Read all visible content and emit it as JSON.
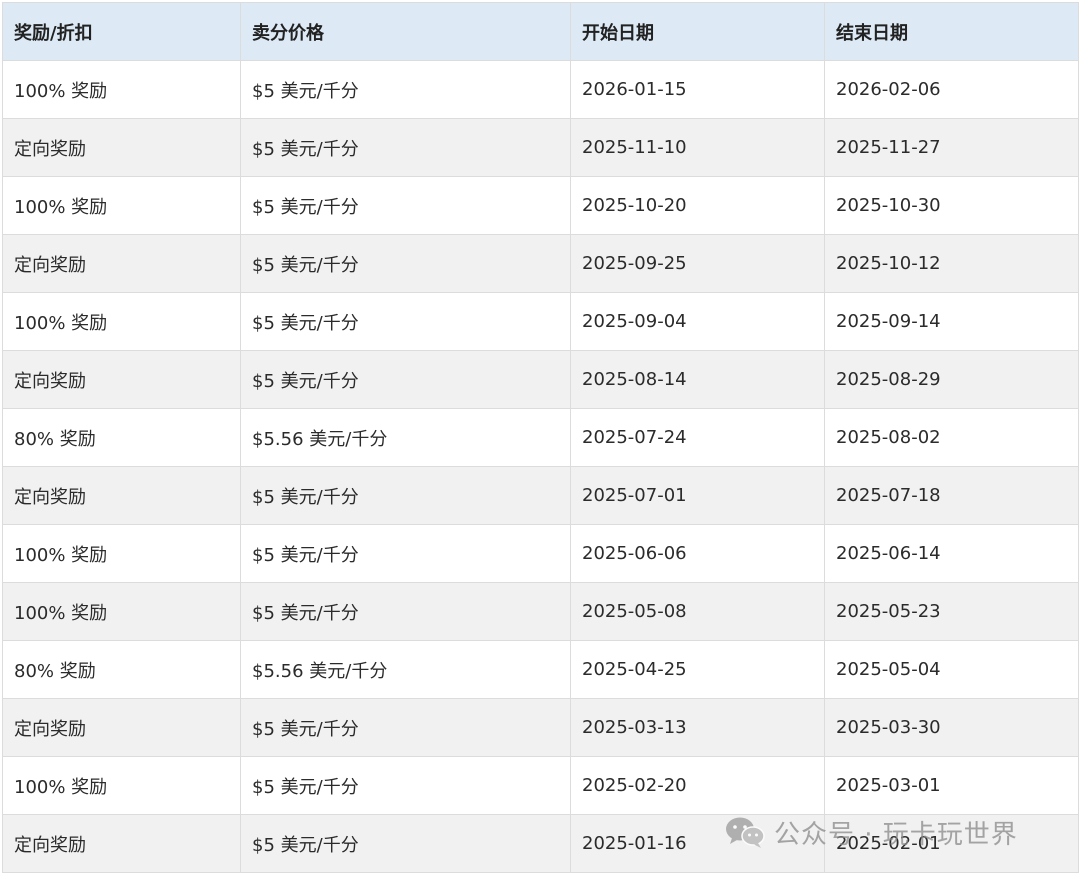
{
  "table": {
    "headers": [
      "奖励/折扣",
      "卖分价格",
      "开始日期",
      "结束日期"
    ],
    "rows": [
      [
        "100% 奖励",
        "$5 美元/千分",
        "2026-01-15",
        "2026-02-06"
      ],
      [
        "定向奖励",
        "$5 美元/千分",
        "2025-11-10",
        "2025-11-27"
      ],
      [
        "100% 奖励",
        "$5 美元/千分",
        "2025-10-20",
        "2025-10-30"
      ],
      [
        "定向奖励",
        "$5 美元/千分",
        "2025-09-25",
        "2025-10-12"
      ],
      [
        "100% 奖励",
        "$5 美元/千分",
        "2025-09-04",
        "2025-09-14"
      ],
      [
        "定向奖励",
        "$5 美元/千分",
        "2025-08-14",
        "2025-08-29"
      ],
      [
        "80% 奖励",
        "$5.56 美元/千分",
        "2025-07-24",
        "2025-08-02"
      ],
      [
        "定向奖励",
        "$5 美元/千分",
        "2025-07-01",
        "2025-07-18"
      ],
      [
        "100% 奖励",
        "$5 美元/千分",
        "2025-06-06",
        "2025-06-14"
      ],
      [
        "100% 奖励",
        "$5 美元/千分",
        "2025-05-08",
        "2025-05-23"
      ],
      [
        "80% 奖励",
        "$5.56 美元/千分",
        "2025-04-25",
        "2025-05-04"
      ],
      [
        "定向奖励",
        "$5 美元/千分",
        "2025-03-13",
        "2025-03-30"
      ],
      [
        "100% 奖励",
        "$5 美元/千分",
        "2025-02-20",
        "2025-03-01"
      ],
      [
        "定向奖励",
        "$5 美元/千分",
        "2025-01-16",
        "2025-02-01"
      ]
    ]
  },
  "watermark": {
    "text": "公众号 · 玩卡玩世界",
    "icon": "wechat-icon"
  },
  "colors": {
    "header_bg": "#ddeaf6",
    "stripe_bg": "#f1f1f1",
    "border": "#dcdcdc"
  }
}
